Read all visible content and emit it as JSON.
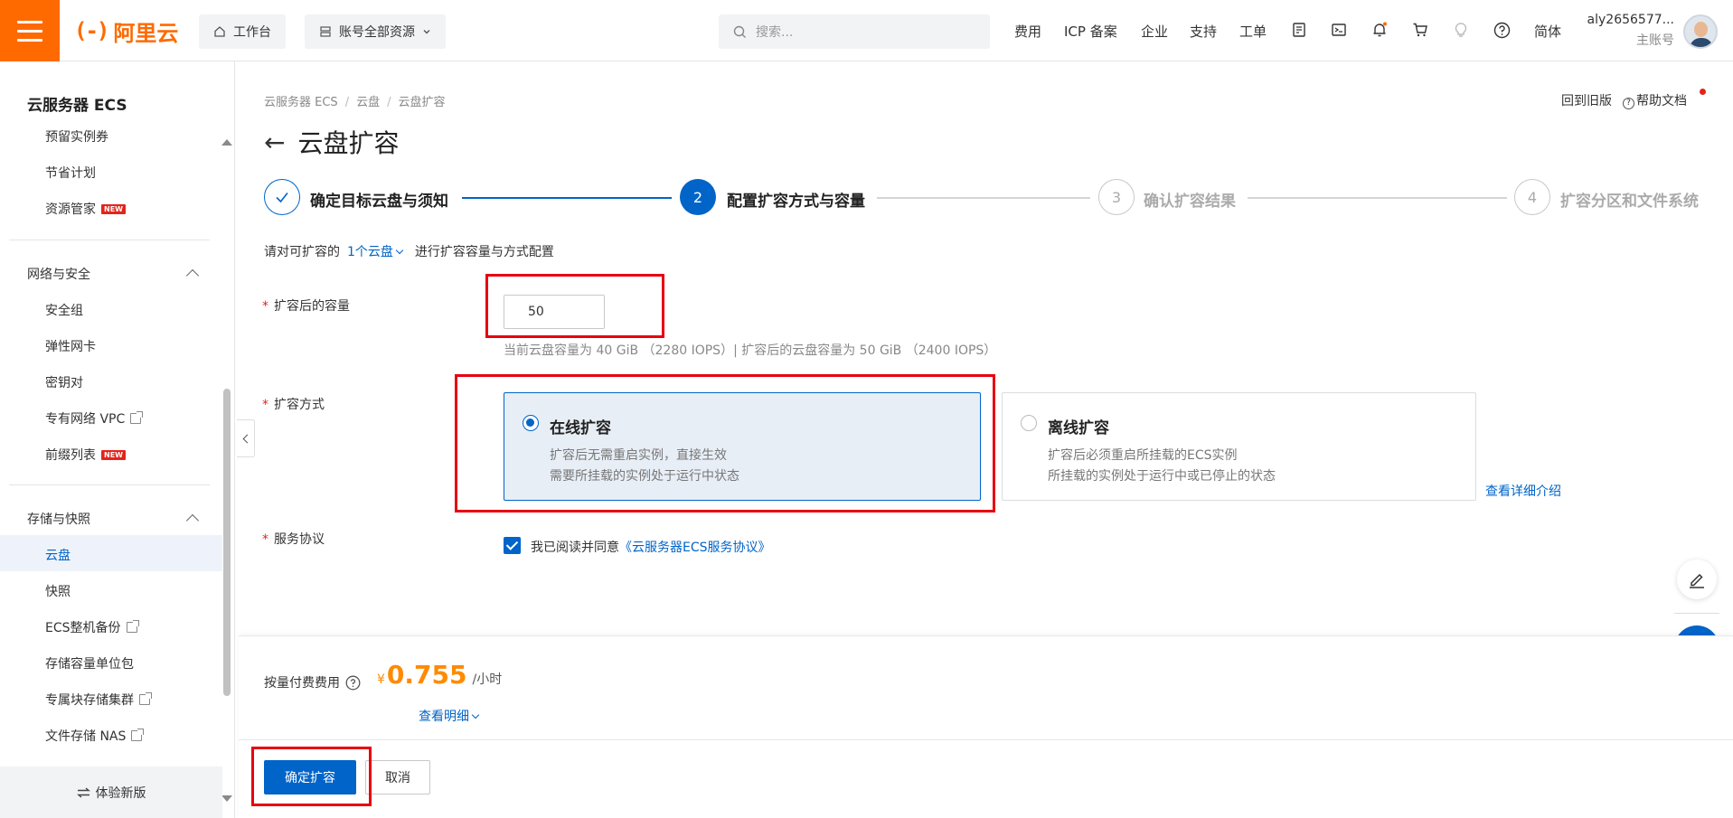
{
  "topbar": {
    "logo_mark": "(-)",
    "logo_text": "阿里云",
    "workbench": "工作台",
    "resources": "账号全部资源",
    "search_placeholder": "搜索...",
    "links": [
      "费用",
      "ICP 备案",
      "企业",
      "支持",
      "工单"
    ],
    "lang": "简体",
    "user_name": "aly2656577...",
    "user_role": "主账号"
  },
  "sidebar": {
    "title": "云服务器 ECS",
    "items_top": [
      "预留实例券",
      "节省计划",
      "资源管家"
    ],
    "group_network": "网络与安全",
    "network_items": [
      "安全组",
      "弹性网卡",
      "密钥对",
      "专有网络 VPC",
      "前缀列表"
    ],
    "group_storage": "存储与快照",
    "storage_items": [
      "云盘",
      "快照",
      "ECS整机备份",
      "存储容量单位包",
      "专属块存储集群",
      "文件存储 NAS"
    ],
    "new_badge": "NEW",
    "try_new": "体验新版"
  },
  "breadcrumb": [
    "云服务器 ECS",
    "云盘",
    "云盘扩容"
  ],
  "header_links": {
    "old_version": "回到旧版",
    "help_doc": "帮助文档"
  },
  "page_title": "云盘扩容",
  "steps": [
    {
      "number": "",
      "label": "确定目标云盘与须知",
      "state": "done"
    },
    {
      "number": "2",
      "label": "配置扩容方式与容量",
      "state": "active"
    },
    {
      "number": "3",
      "label": "确认扩容结果",
      "state": "todo"
    },
    {
      "number": "4",
      "label": "扩容分区和文件系统",
      "state": "todo"
    }
  ],
  "intro": {
    "prefix": "请对可扩容的",
    "link": "1个云盘",
    "suffix": "进行扩容容量与方式配置"
  },
  "form": {
    "capacity_label": "扩容后的容量",
    "capacity_value": "50",
    "capacity_hint": "当前云盘容量为 40 GiB （2280 IOPS）| 扩容后的云盘容量为 50 GiB （2400 IOPS）",
    "method_label": "扩容方式",
    "online_title": "在线扩容",
    "online_desc1": "扩容后无需重启实例，直接生效",
    "online_desc2": "需要所挂载的实例处于运行中状态",
    "offline_title": "离线扩容",
    "offline_desc1": "扩容后必须重启所挂载的ECS实例",
    "offline_desc2": "所挂载的实例处于运行中或已停止的状态",
    "detail_link": "查看详细介绍",
    "agreement_label": "服务协议",
    "agreement_text": "我已阅读并同意",
    "agreement_link": "《云服务器ECS服务协议》"
  },
  "cost": {
    "label": "按量付费费用",
    "currency": "¥",
    "amount": "0.755",
    "unit": "/小时",
    "detail": "查看明细"
  },
  "buttons": {
    "confirm": "确定扩容",
    "cancel": "取消"
  },
  "colors": {
    "accent": "#0064c8",
    "brand": "#ff6a00",
    "price": "#ff8a00",
    "highlight": "#e60012"
  }
}
